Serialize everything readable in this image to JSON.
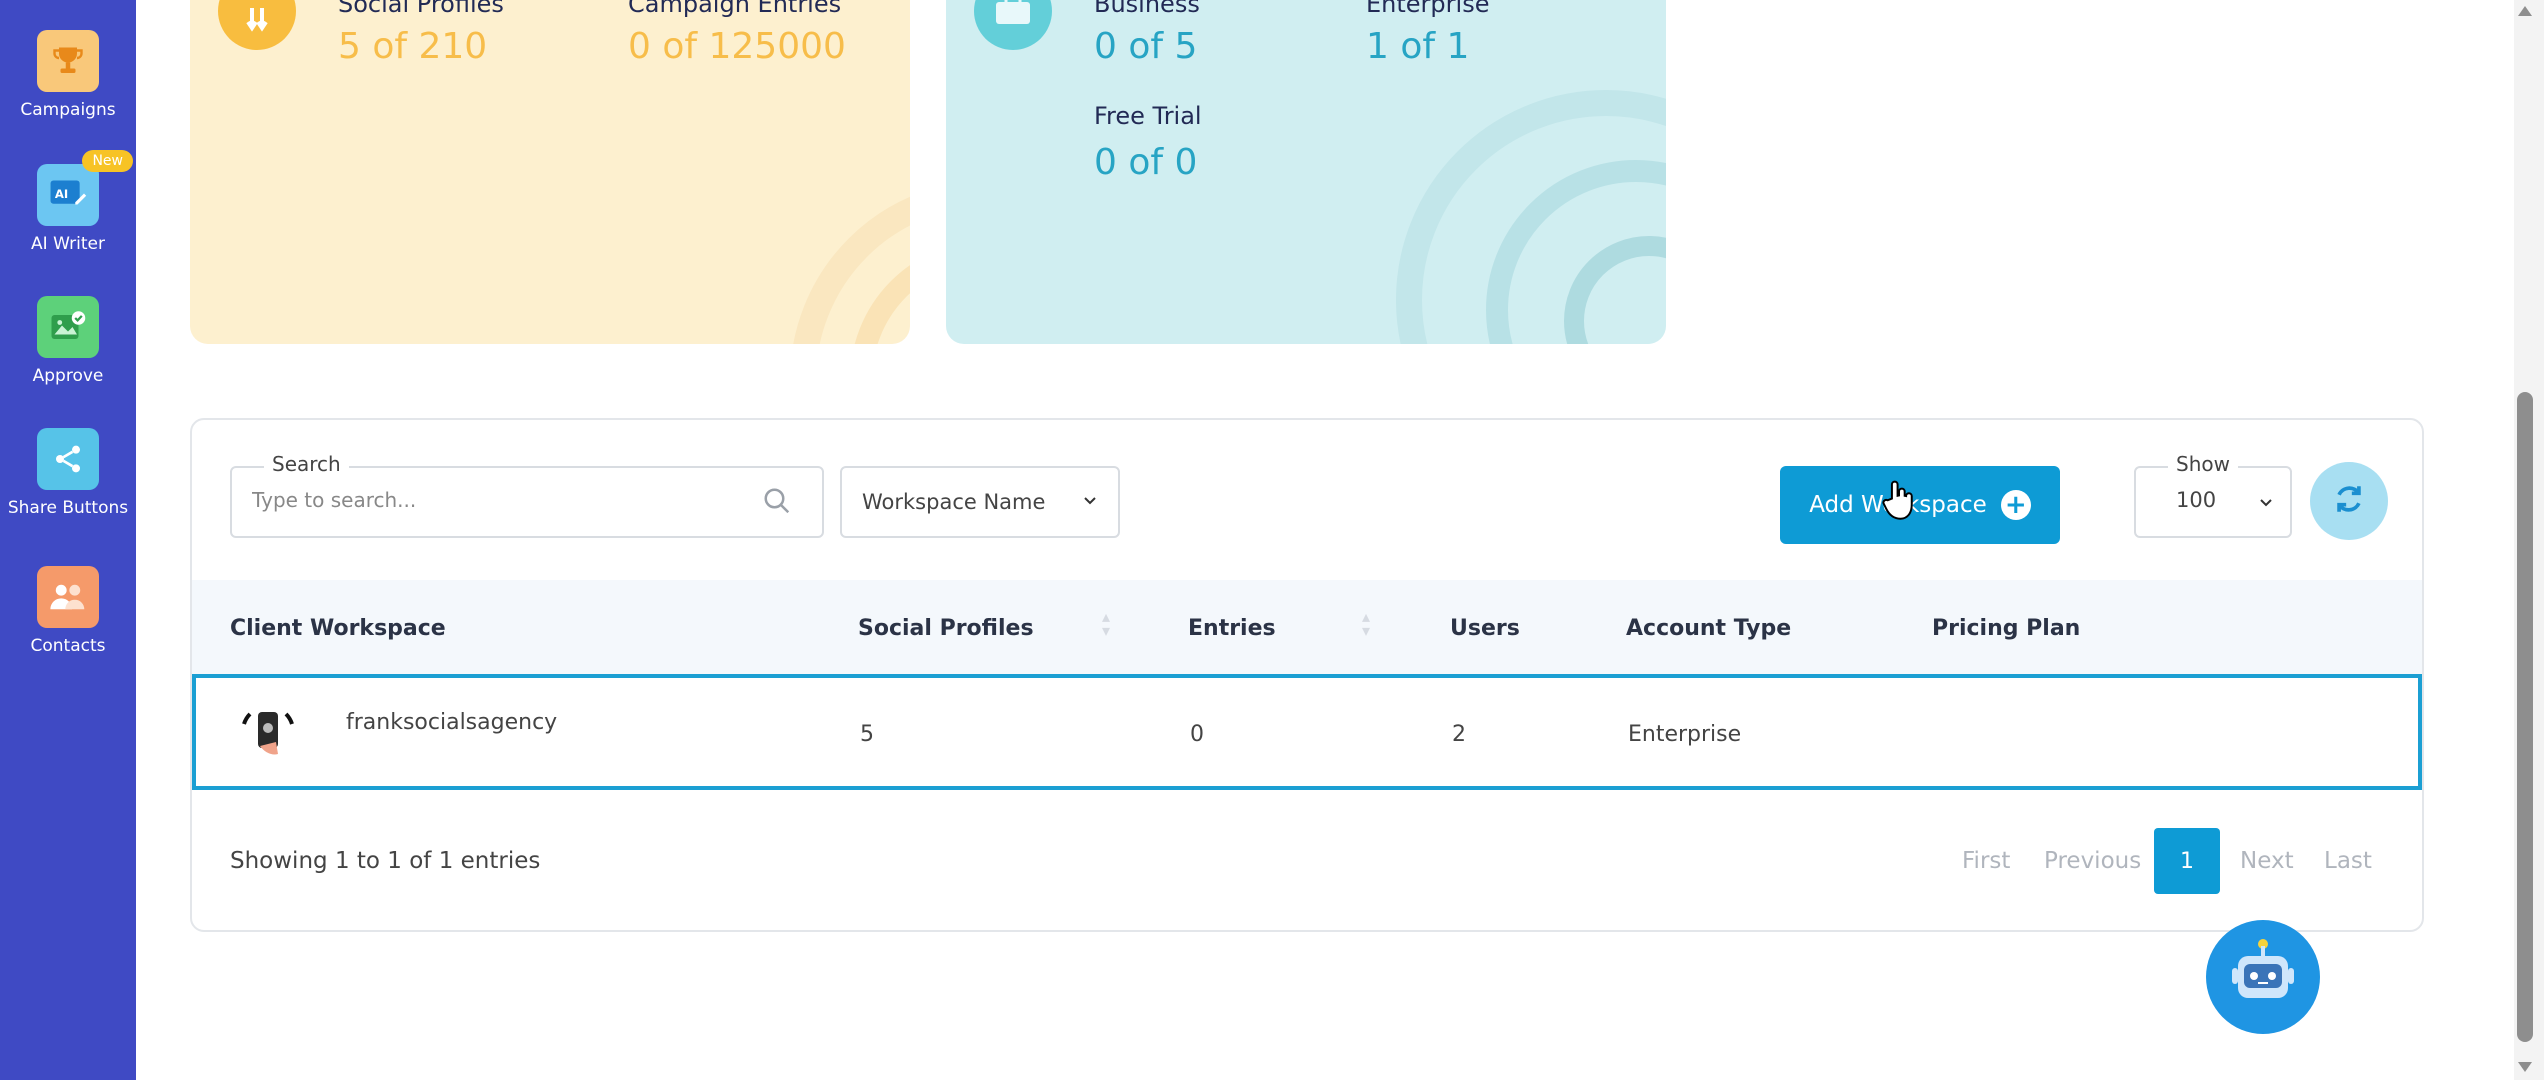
{
  "sidebar": {
    "items": [
      {
        "label": "Campaigns",
        "icon": "trophy-icon",
        "color": "#f9c87a"
      },
      {
        "label": "AI Writer",
        "icon": "ai-writer-icon",
        "color": "#6cc6f2",
        "badge": "New"
      },
      {
        "label": "Approve",
        "icon": "image-check-icon",
        "color": "#5dd17a"
      },
      {
        "label": "Share Buttons",
        "icon": "share-icon",
        "color": "#56c3e8"
      },
      {
        "label": "Contacts",
        "icon": "contacts-icon",
        "color": "#f59a6a"
      }
    ]
  },
  "stats_left": {
    "items": [
      {
        "label": "Social Profiles",
        "value": "5 of 210"
      },
      {
        "label": "Campaign Entries",
        "value": "0 of 125000"
      }
    ]
  },
  "stats_right": {
    "items": [
      {
        "label": "Business",
        "value": "0 of 5"
      },
      {
        "label": "Enterprise",
        "value": "1 of 1"
      },
      {
        "label": "Free Trial",
        "value": "0 of 0"
      }
    ]
  },
  "toolbar": {
    "search_legend": "Search",
    "search_placeholder": "Type to search...",
    "filter_selected": "Workspace Name",
    "add_button": "Add Workspace",
    "show_legend": "Show",
    "show_selected": "100"
  },
  "table": {
    "columns": [
      "Client Workspace",
      "Social Profiles",
      "Entries",
      "Users",
      "Account Type",
      "Pricing Plan"
    ],
    "rows": [
      {
        "workspace": "franksocialsagency",
        "social_profiles": "5",
        "entries": "0",
        "users": "2",
        "account_type": "Enterprise",
        "pricing_plan": ""
      }
    ]
  },
  "footer": {
    "info": "Showing 1 to 1 of 1 entries",
    "pagination": {
      "first": "First",
      "previous": "Previous",
      "current": "1",
      "next": "Next",
      "last": "Last"
    }
  },
  "colors": {
    "sidebar": "#3f4ac4",
    "accent": "#0e9bd5",
    "card_yellow": "#fdf0cf",
    "card_blue": "#d0eef1"
  }
}
